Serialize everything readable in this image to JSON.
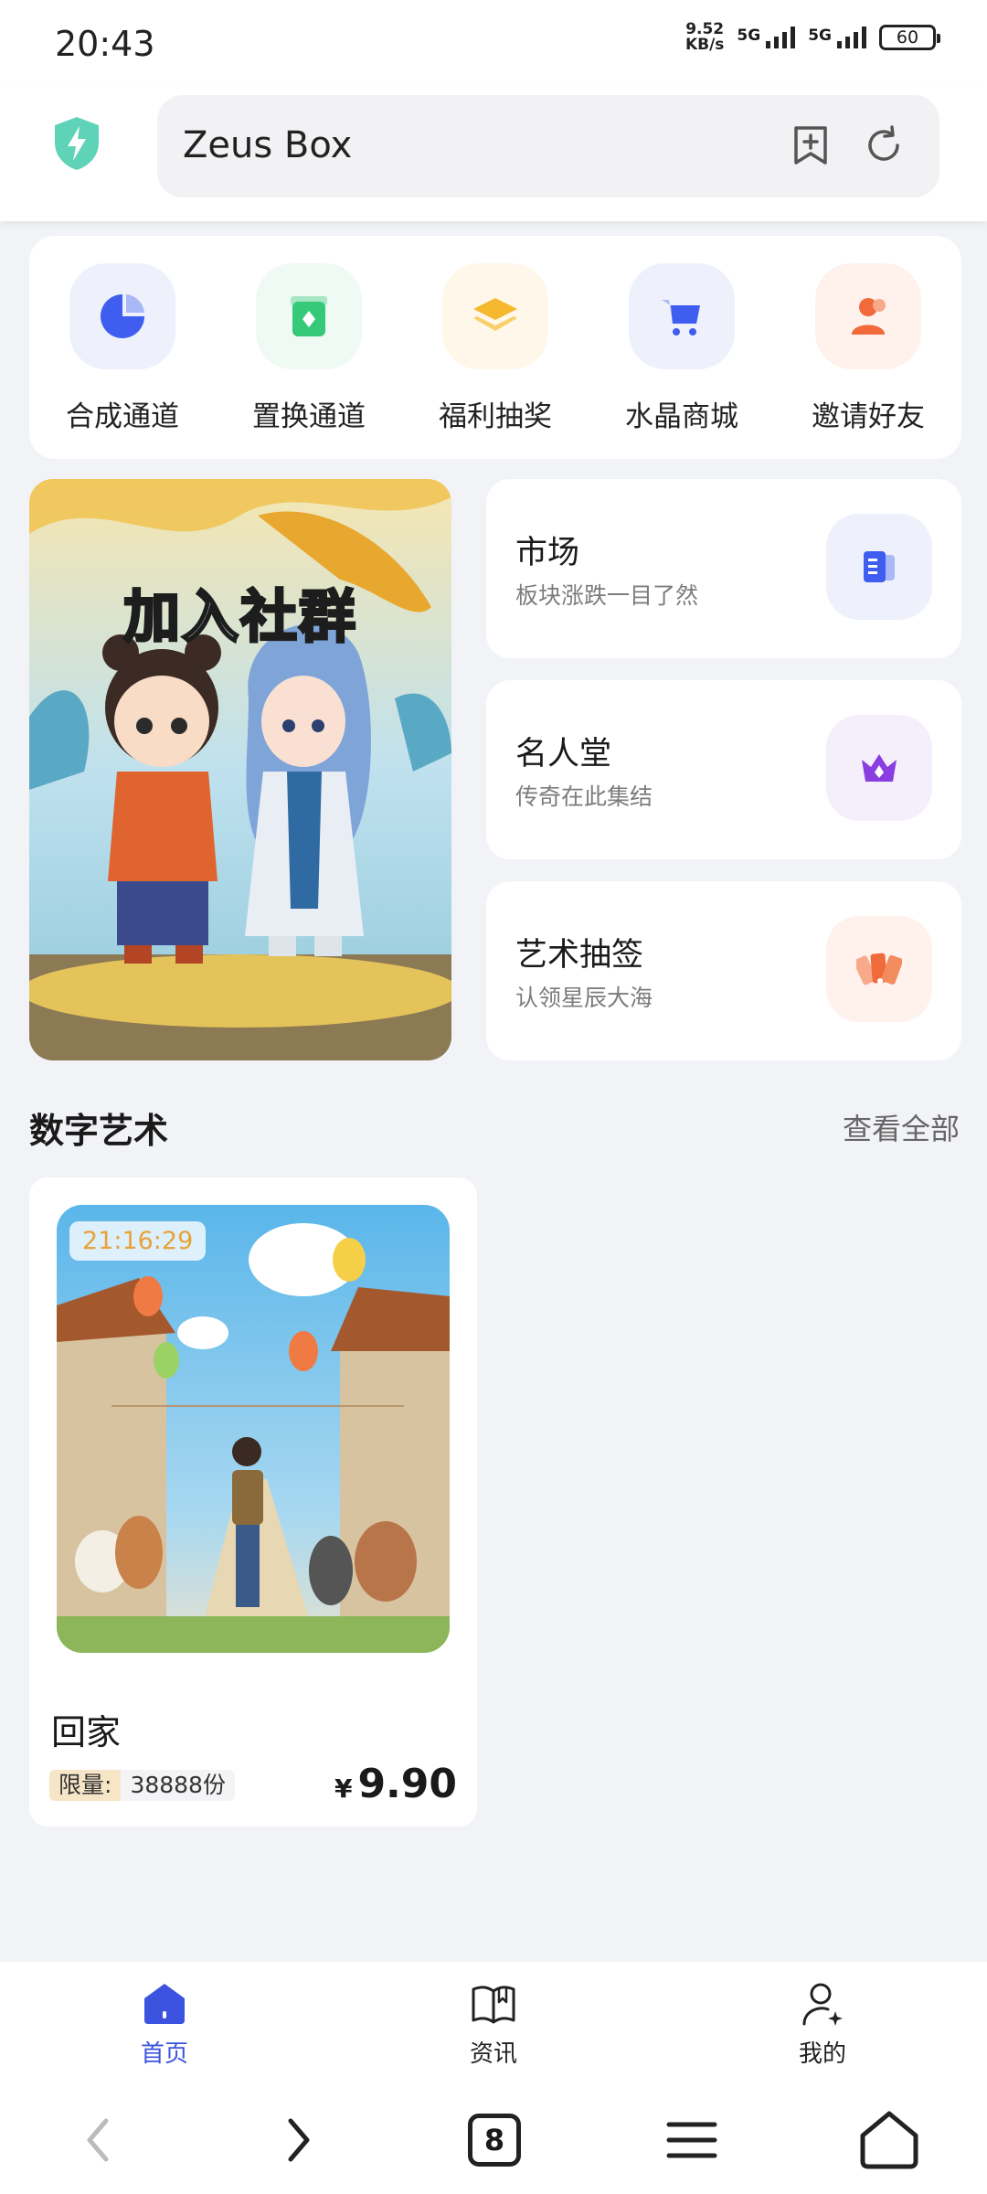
{
  "status": {
    "time": "20:43",
    "net_speed_value": "9.52",
    "net_speed_unit": "KB/s",
    "signal1_label": "5G",
    "signal2_label": "5G",
    "battery": "60"
  },
  "browser": {
    "site_title": "Zeus Box",
    "icons": [
      "shield-bolt-icon",
      "bookmark-add-icon",
      "refresh-icon"
    ]
  },
  "quick_nav": [
    {
      "label": "合成通道",
      "icon": "synthesis-icon",
      "color": "#3f5ef0"
    },
    {
      "label": "置换通道",
      "icon": "exchange-icon",
      "color": "#36c97a"
    },
    {
      "label": "福利抽奖",
      "icon": "layers-icon",
      "color": "#f5b82e"
    },
    {
      "label": "水晶商城",
      "icon": "cart-icon",
      "color": "#3f5ef0"
    },
    {
      "label": "邀请好友",
      "icon": "user-icon",
      "color": "#f06a3a"
    }
  ],
  "banner": {
    "title": "加入社群"
  },
  "features": [
    {
      "title": "市场",
      "subtitle": "板块涨跌一目了然",
      "icon": "market-icon"
    },
    {
      "title": "名人堂",
      "subtitle": "传奇在此集结",
      "icon": "crown-icon"
    },
    {
      "title": "艺术抽签",
      "subtitle": "认领星辰大海",
      "icon": "fan-cards-icon"
    }
  ],
  "section": {
    "title": "数字艺术",
    "more": "查看全部"
  },
  "product": {
    "timer": "21:16:29",
    "name": "回家",
    "limit_tag": "限量:",
    "limit_value": "38888份",
    "currency": "¥",
    "price": "9.90"
  },
  "tabs": [
    {
      "label": "首页",
      "icon": "home-icon",
      "active": true
    },
    {
      "label": "资讯",
      "icon": "book-icon",
      "active": false
    },
    {
      "label": "我的",
      "icon": "profile-icon",
      "active": false
    }
  ],
  "system_nav": {
    "tab_count": "8",
    "icons": [
      "back-icon",
      "forward-icon",
      "tabs-icon",
      "menu-icon",
      "home-outline-icon"
    ]
  },
  "colors": {
    "accent": "#3c53e0",
    "background": "#f2f3f7",
    "timer_text": "#e8a23a"
  }
}
